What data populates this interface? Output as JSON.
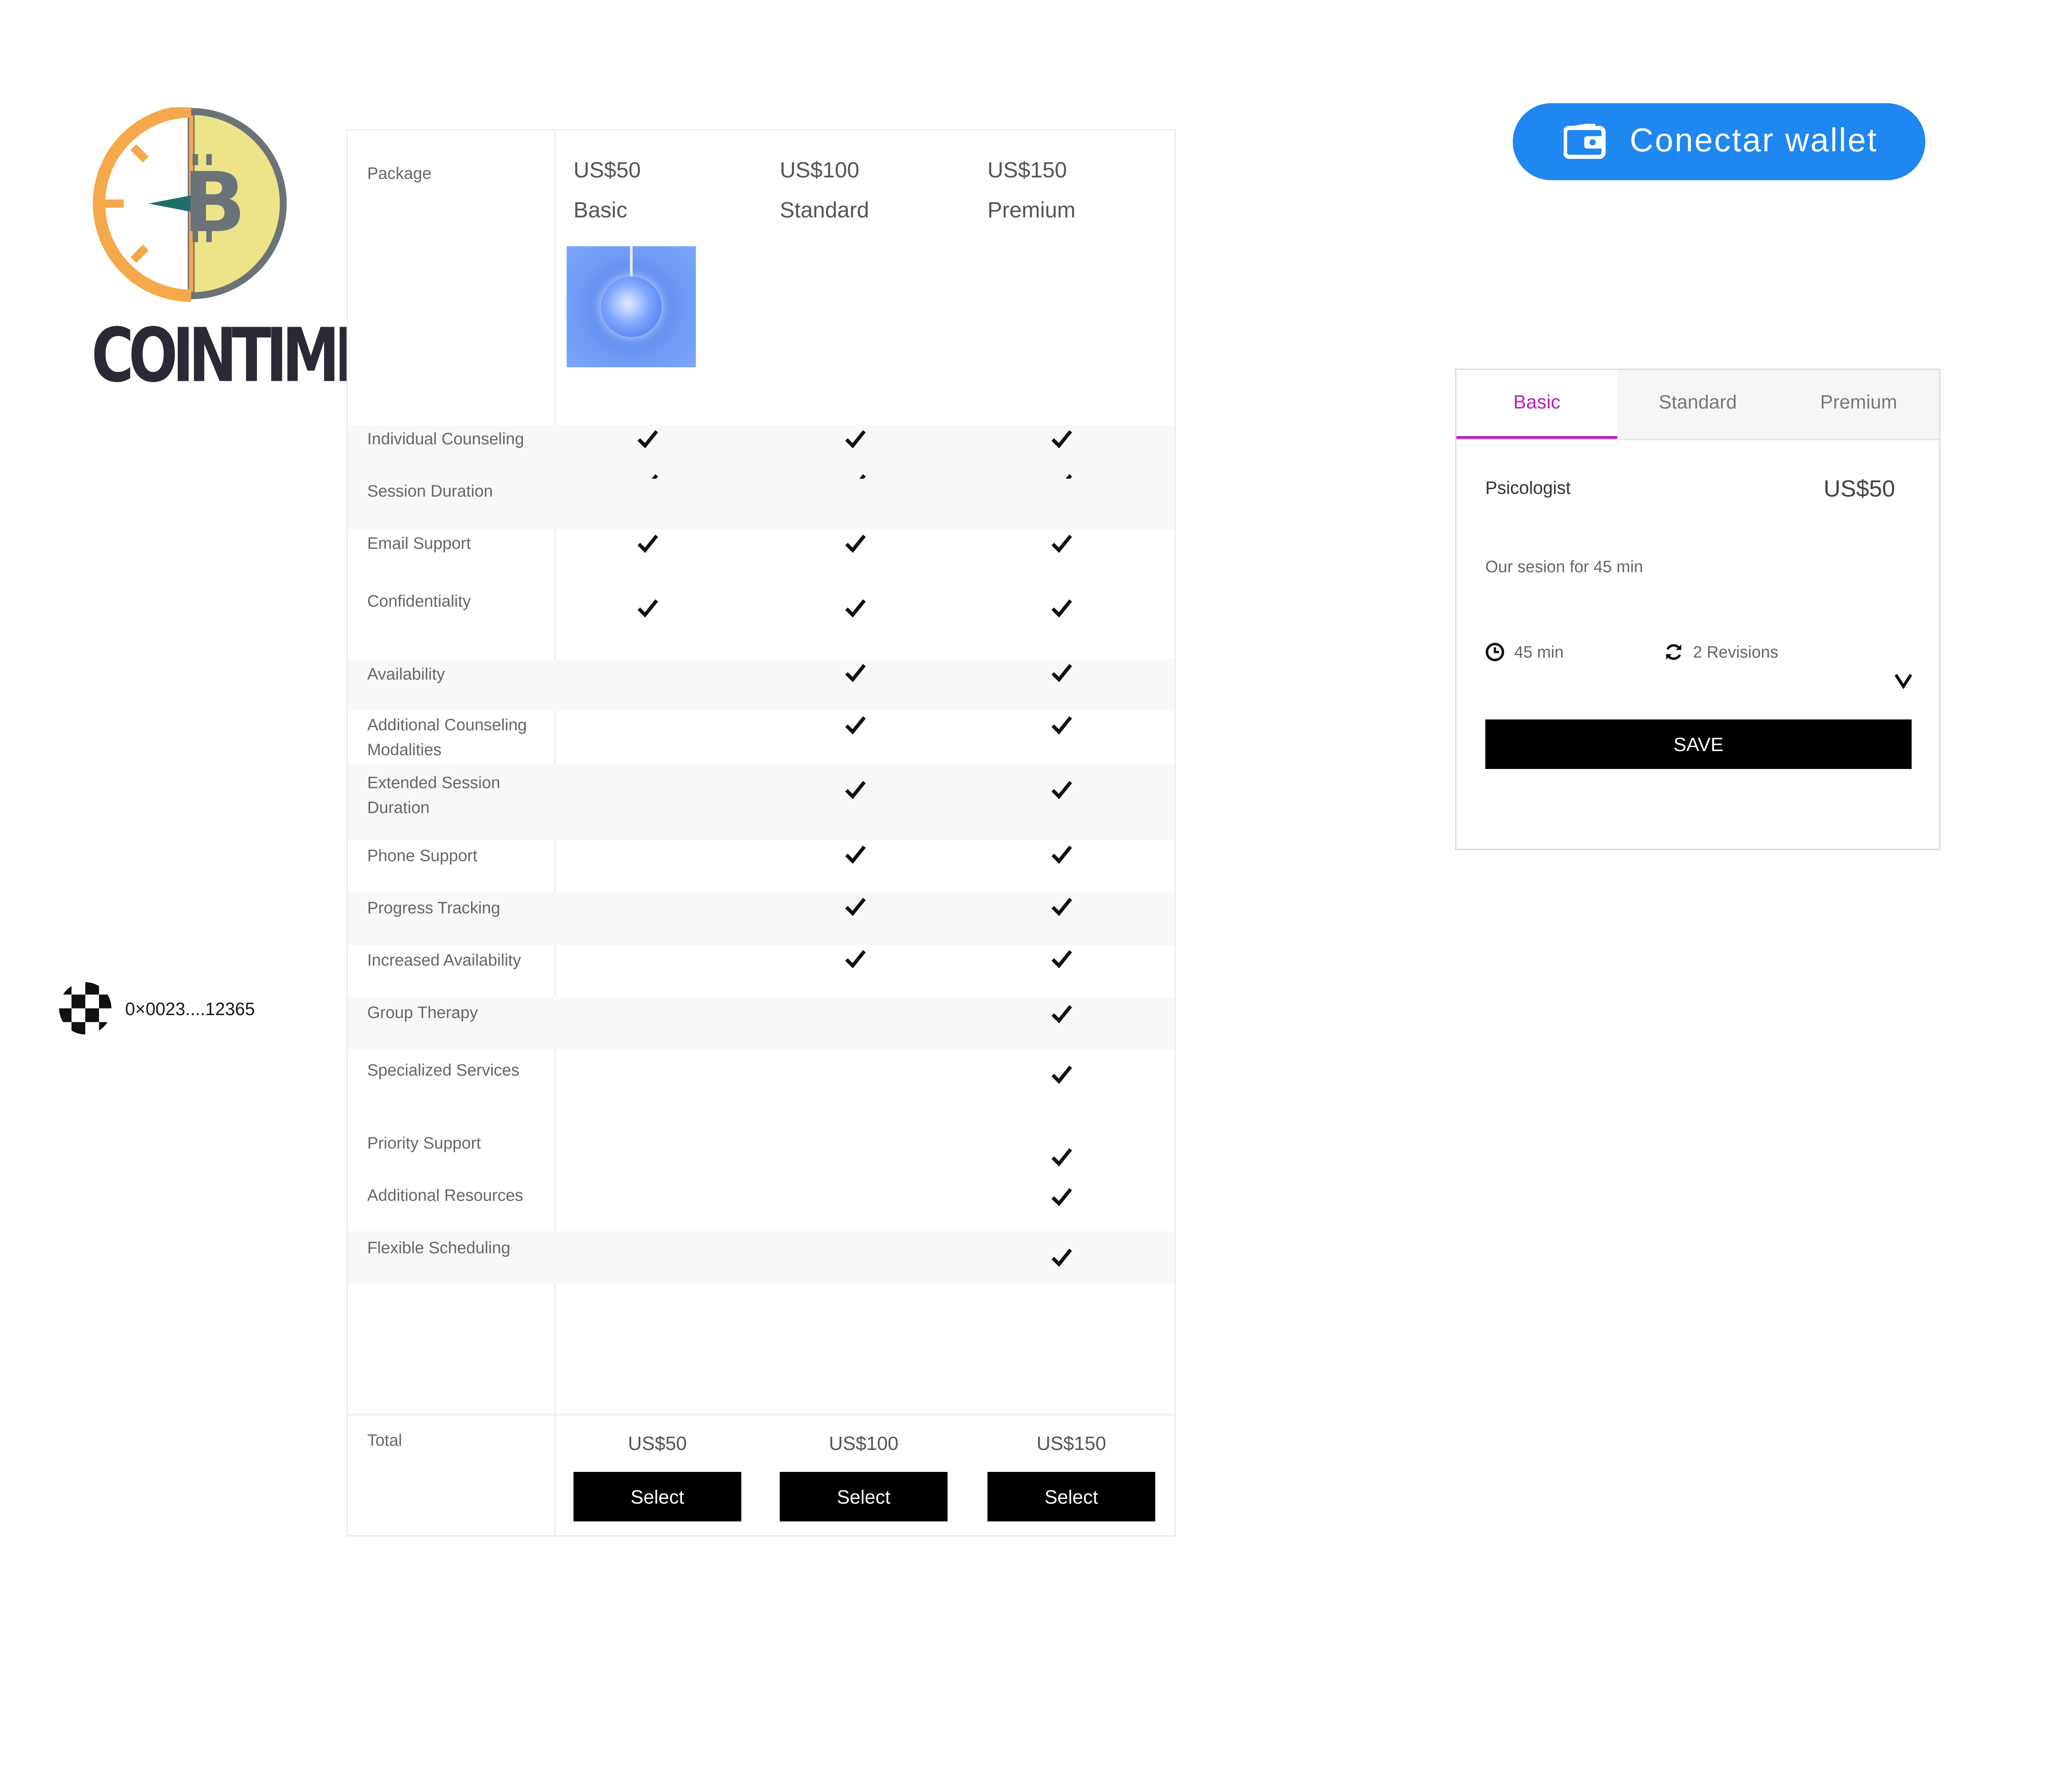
{
  "brand": {
    "name": "COINTIME"
  },
  "wallet_address": "0×0023....12365",
  "connect_wallet": {
    "label": "Conectar wallet"
  },
  "packages": {
    "header_label": "Package",
    "columns": [
      {
        "price": "US$50",
        "name": "Basic"
      },
      {
        "price": "US$100",
        "name": "Standard"
      },
      {
        "price": "US$150",
        "name": "Premium"
      }
    ],
    "features": [
      {
        "label": "Individual Counseling",
        "included": [
          true,
          true,
          true
        ]
      },
      {
        "label": "Session Duration",
        "included": [
          true,
          true,
          true
        ]
      },
      {
        "label": "Email Support",
        "included": [
          true,
          true,
          true
        ]
      },
      {
        "label": "Confidentiality",
        "included": [
          true,
          true,
          true
        ]
      },
      {
        "label": "Availability",
        "included": [
          false,
          true,
          true
        ]
      },
      {
        "label": "Additional Counseling Modalities",
        "included": [
          false,
          true,
          true
        ]
      },
      {
        "label": "Extended Session Duration",
        "included": [
          false,
          true,
          true
        ]
      },
      {
        "label": "Phone Support",
        "included": [
          false,
          true,
          true
        ]
      },
      {
        "label": "Progress Tracking",
        "included": [
          false,
          true,
          true
        ]
      },
      {
        "label": "Increased Availability",
        "included": [
          false,
          true,
          true
        ]
      },
      {
        "label": "Group Therapy",
        "included": [
          false,
          false,
          true
        ]
      },
      {
        "label": "Specialized Services",
        "included": [
          false,
          false,
          true
        ]
      },
      {
        "label": "Priority Support",
        "included": [
          false,
          false,
          true
        ]
      },
      {
        "label": "Additional Resources",
        "included": [
          false,
          false,
          true
        ]
      },
      {
        "label": "Flexible Scheduling",
        "included": [
          false,
          false,
          true
        ]
      }
    ],
    "total_label": "Total",
    "totals": [
      "US$50",
      "US$100",
      "US$150"
    ],
    "select_label": "Select"
  },
  "card": {
    "tabs": [
      "Basic",
      "Standard",
      "Premium"
    ],
    "active_tab": "Basic",
    "title": "Psicologist",
    "price": "US$50",
    "description": "Our sesion for 45 min",
    "duration": "45 min",
    "revisions": "2 Revisions",
    "save_label": "SAVE"
  },
  "colors": {
    "accent": "#b81fc0",
    "wallet_button": "#1e87f0",
    "logo_orange": "#f5a94a",
    "logo_yellow": "#ede48a",
    "logo_gray": "#6b7378"
  }
}
